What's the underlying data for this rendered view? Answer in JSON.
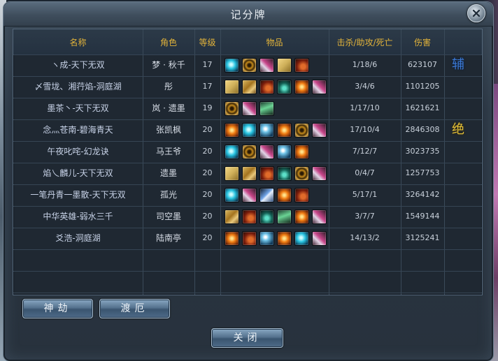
{
  "window": {
    "title": "记分牌",
    "close_label": "close"
  },
  "table": {
    "headers": {
      "name": "名称",
      "role": "角色",
      "level": "等级",
      "items": "物品",
      "kda": "击杀/助攻/死亡",
      "damage": "伤害"
    },
    "rows": [
      {
        "name": "ヽ成-天下无双",
        "role": "梦 · 秋千",
        "level": "17",
        "items": [
          "orb",
          "swirl",
          "wings",
          "scroll",
          "gourd"
        ],
        "kda": "1/18/6",
        "damage": "623107",
        "badge": "辅"
      },
      {
        "name": "〆雪垅、湘荇焰-洞庭湖",
        "role": "彤",
        "level": "17",
        "items": [
          "scroll",
          "knot",
          "gourd",
          "potion",
          "fire",
          "wings"
        ],
        "kda": "3/4/6",
        "damage": "1101205",
        "badge": ""
      },
      {
        "name": "墨茶丶-天下无双",
        "role": "岚 · 遗墨",
        "level": "19",
        "items": [
          "swirl",
          "wings",
          "bottle"
        ],
        "kda": "1/17/10",
        "damage": "1621621",
        "badge": ""
      },
      {
        "name": "念灬苍南-碧海青天",
        "role": "张凯枫",
        "level": "20",
        "items": [
          "fire",
          "orb",
          "wave",
          "fire",
          "swirl",
          "wings"
        ],
        "kda": "17/10/4",
        "damage": "2846308",
        "badge": "绝"
      },
      {
        "name": "午夜叱咤-幻龙诀",
        "role": "马王爷",
        "level": "20",
        "items": [
          "orb",
          "swirl",
          "wings",
          "wave",
          "fire"
        ],
        "kda": "7/12/7",
        "damage": "3023735",
        "badge": ""
      },
      {
        "name": "焰乀麟儿-天下无双",
        "role": "遗墨",
        "level": "20",
        "items": [
          "scroll",
          "knot",
          "gourd",
          "potion",
          "swirl",
          "wings"
        ],
        "kda": "0/4/7",
        "damage": "1257753",
        "badge": ""
      },
      {
        "name": "一笔丹青一墨散-天下无双",
        "role": "孤光",
        "level": "20",
        "items": [
          "orb",
          "wings",
          "blade",
          "fire",
          "gourd"
        ],
        "kda": "5/17/1",
        "damage": "3264142",
        "badge": ""
      },
      {
        "name": "中华英雄-弱水三千",
        "role": "司空墨",
        "level": "20",
        "items": [
          "knot",
          "gourd",
          "potion",
          "bottle",
          "fire",
          "wings"
        ],
        "kda": "3/7/7",
        "damage": "1549144",
        "badge": ""
      },
      {
        "name": "爻浩-洞庭湖",
        "role": "陆南亭",
        "level": "20",
        "items": [
          "fire",
          "gourd",
          "wave",
          "fire",
          "orb",
          "wings"
        ],
        "kda": "14/13/2",
        "damage": "3125241",
        "badge": ""
      }
    ]
  },
  "buttons": {
    "shenjie": "神劫",
    "due": "渡厄",
    "close": "关闭"
  },
  "colors": {
    "header_text": "#e2b33a",
    "badge_fu": "#3b79d6",
    "badge_jue": "#e6c238"
  }
}
